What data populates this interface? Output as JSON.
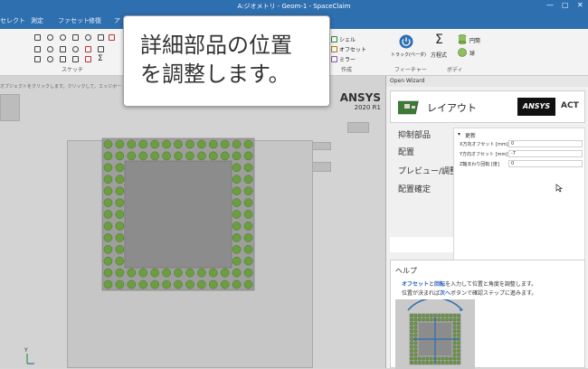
{
  "window": {
    "title": "A:ジオメトリ - Geom-1 - SpaceClaim",
    "controls": [
      "—",
      "▢",
      "✕"
    ]
  },
  "ribbon_tabs": [
    "セレクト",
    "測定",
    "ファセット",
    "修復",
    "ア"
  ],
  "ribbon": {
    "sketch_label": "スケッチ",
    "create_label": "作成",
    "create_tools": [
      "シェル",
      "オフセット",
      "ミラー"
    ],
    "feature_label": "フィーチャー",
    "feature_tool": "トラック(ベーダ)",
    "body_label": "ボディ",
    "body_tools": [
      "方程式",
      "円筒",
      "球"
    ],
    "sigma": "Σ"
  },
  "hint_text": "オブジェクトをクリックします。クリックして、エッジボー",
  "callout": {
    "line1": "詳細部品の位置",
    "line2": "を調整します。"
  },
  "viewport_brand": {
    "name": "ANSYS",
    "version": "2020 R1"
  },
  "axis": {
    "y": "Y",
    "z": "Z"
  },
  "package": {
    "ball_color": "#6b9e3f",
    "cols": 13,
    "rows": 13
  },
  "wizard": {
    "title": "Open Wizard",
    "header_title": "レイアウト",
    "badge": "ANSYS",
    "badge_suffix": "ACT",
    "steps": [
      "抑制部品",
      "配置",
      "プレビュー/調整",
      "配置確定"
    ],
    "active_step": 2,
    "section_title": "更新",
    "fields": [
      {
        "label": "X方向オフセット [mm]",
        "value": "0"
      },
      {
        "label": "Y方向オフセット [mm]",
        "value": "-7"
      },
      {
        "label": "Z軸まわり回転 [度]",
        "value": "0"
      }
    ],
    "help": {
      "title": "ヘルプ",
      "line1_pre": "",
      "line1_kw1": "オフセット",
      "line1_mid": "と",
      "line1_kw2": "回転",
      "line1_post": "を入力して位置と角度を調整します。",
      "line2_pre": "位置が決まれば",
      "line2_kw": "次へ",
      "line2_post": "ボタンで確認ステップに進みます。"
    }
  }
}
